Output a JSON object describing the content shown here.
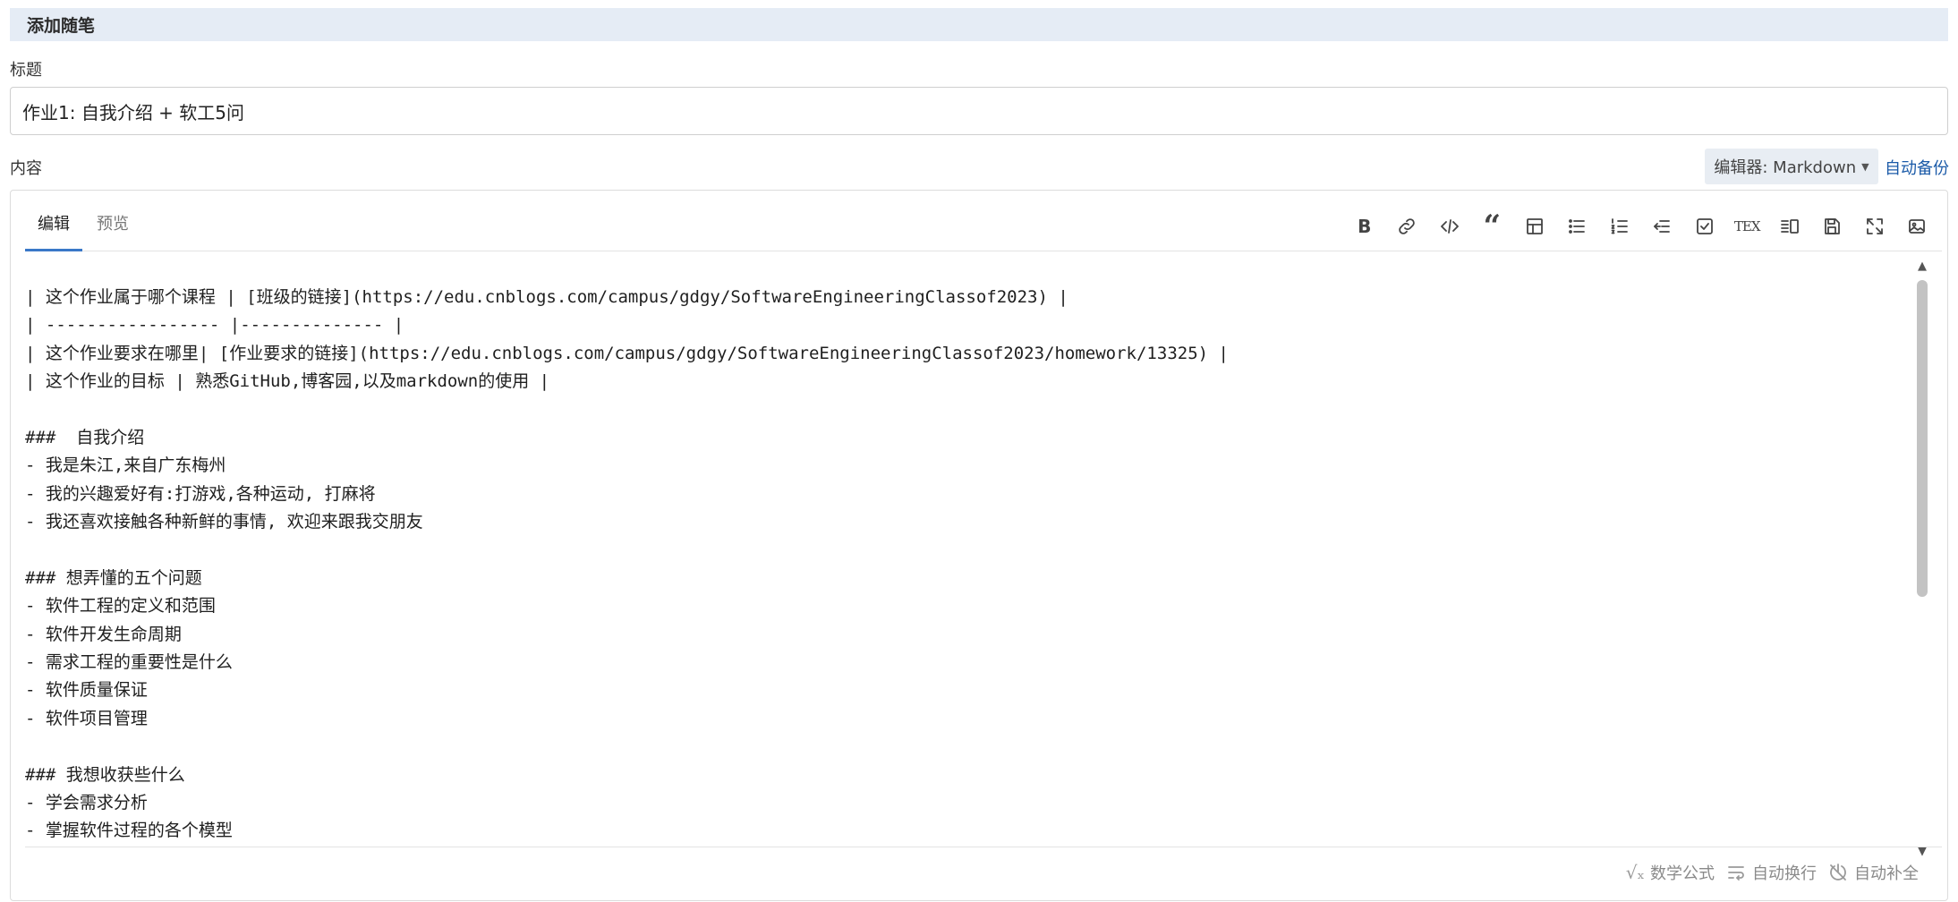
{
  "header": {
    "title": "添加随笔"
  },
  "title_field": {
    "label": "标题",
    "value": "作业1: 自我介绍 + 软工5问"
  },
  "content_field": {
    "label": "内容"
  },
  "editor_select": {
    "label": "编辑器: Markdown"
  },
  "auto_backup": {
    "label": "自动备份"
  },
  "tabs": [
    {
      "label": "编辑"
    },
    {
      "label": "预览"
    }
  ],
  "toolbar": [
    {
      "icon": "bold-icon",
      "glyph": "B"
    },
    {
      "icon": "link-icon"
    },
    {
      "icon": "code-icon"
    },
    {
      "icon": "quote-icon",
      "glyph": "“"
    },
    {
      "icon": "table-icon"
    },
    {
      "icon": "bulleted-list-icon"
    },
    {
      "icon": "numbered-list-icon"
    },
    {
      "icon": "outdent-icon"
    },
    {
      "icon": "checkbox-icon"
    },
    {
      "icon": "tex-icon",
      "glyph": "TEX"
    },
    {
      "icon": "split-view-icon"
    },
    {
      "icon": "save-icon"
    },
    {
      "icon": "fullscreen-icon"
    },
    {
      "icon": "image-icon"
    }
  ],
  "content_lines": [
    "| 这个作业属于哪个课程 | [班级的链接](https://edu.cnblogs.com/campus/gdgy/SoftwareEngineeringClassof2023) |",
    "| ----------------- |-------------- |",
    "| 这个作业要求在哪里| [作业要求的链接](https://edu.cnblogs.com/campus/gdgy/SoftwareEngineeringClassof2023/homework/13325) |",
    "| 这个作业的目标 | 熟悉GitHub,博客园,以及markdown的使用 |",
    "",
    "###  自我介绍",
    "- 我是朱江,来自广东梅州",
    "- 我的兴趣爱好有:打游戏,各种运动, 打麻将",
    "- 我还喜欢接触各种新鲜的事情, 欢迎来跟我交朋友",
    "",
    "### 想弄懂的五个问题",
    "- 软件工程的定义和范围",
    "- 软件开发生命周期",
    "- 需求工程的重要性是什么",
    "- 软件质量保证",
    "- 软件项目管理",
    "",
    "### 我想收获些什么",
    "- 学会需求分析",
    "- 掌握软件过程的各个模型"
  ],
  "footer": {
    "math": "数学公式",
    "wrap": "自动换行",
    "autocomplete": "自动补全"
  },
  "colors": {
    "accent": "#3a78c8",
    "link": "#1a5aa8",
    "header_bg": "#e5ecf5"
  }
}
